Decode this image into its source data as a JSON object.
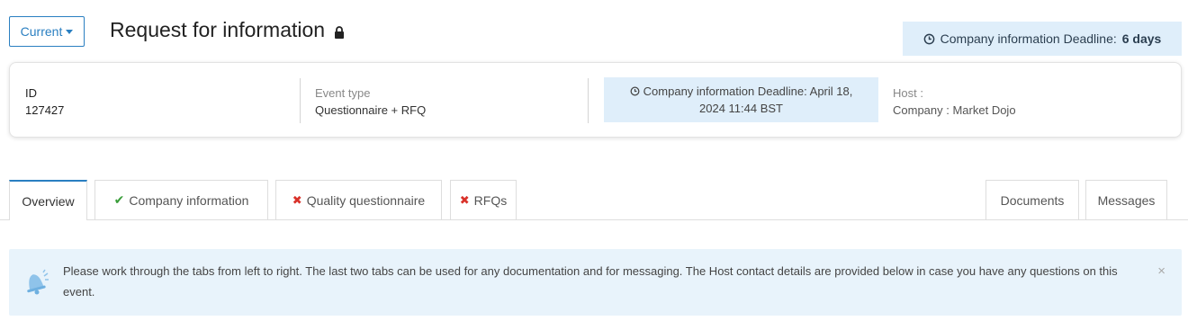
{
  "header": {
    "current_label": "Current",
    "title": "Request for information",
    "deadline_badge": {
      "prefix": "Company information Deadline:",
      "value": "6 days"
    }
  },
  "info": {
    "id_label": "ID",
    "id_value": "127427",
    "event_type_label": "Event type",
    "event_type_value": "Questionnaire + RFQ",
    "deadline_line1": "Company information Deadline: April 18,",
    "deadline_line2": "2024 11:44 BST",
    "host_label": "Host :",
    "company_line": "Company : Market Dojo"
  },
  "tabs": {
    "overview": "Overview",
    "company_information": "Company information",
    "quality_questionnaire": "Quality questionnaire",
    "rfqs": "RFQs",
    "documents": "Documents",
    "messages": "Messages"
  },
  "alert": {
    "text": "Please work through the tabs from left to right. The last two tabs can be used for any documentation and for messaging. The Host contact details are provided below in case you have any questions on this event.",
    "close": "×"
  },
  "colors": {
    "accent": "#2a7fc1",
    "badge_bg": "#dfeefa",
    "alert_bg": "#e8f3fb",
    "success": "#3a9d3a",
    "error": "#d9322a"
  },
  "icons": {
    "lock": "lock-icon",
    "clock": "clock-icon",
    "check": "check-icon",
    "cross": "cross-icon",
    "bell": "bell-icon",
    "close": "close-icon"
  }
}
